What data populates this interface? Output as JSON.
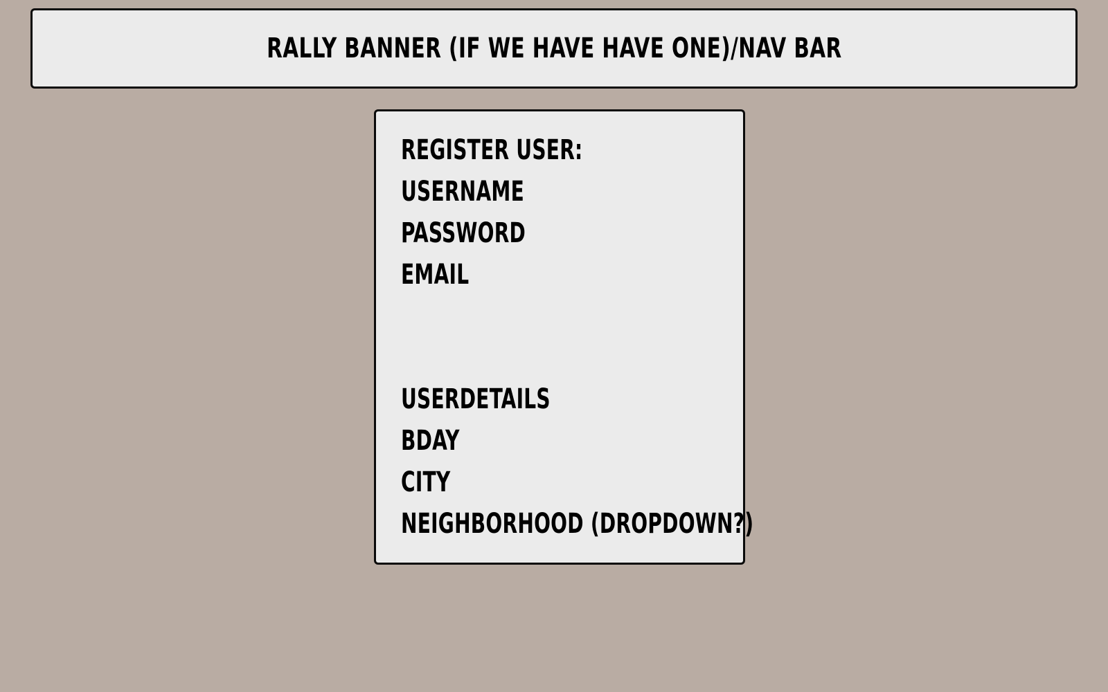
{
  "banner": {
    "text": "RALLY BANNER (IF WE HAVE HAVE ONE)/NAV BAR"
  },
  "register_form": {
    "heading": "REGISTER USER:",
    "fields": {
      "username": "USERNAME",
      "password": "PASSWORD",
      "email": "EMAIL"
    },
    "details_heading": "USERDETAILS",
    "detail_fields": {
      "bday": "BDAY",
      "city": "CITY",
      "neighborhood": "NEIGHBORHOOD (DROPDOWN?)"
    }
  },
  "colors": {
    "background": "#b9aca3",
    "panel": "#ebebeb",
    "border": "#0a0a0a"
  }
}
